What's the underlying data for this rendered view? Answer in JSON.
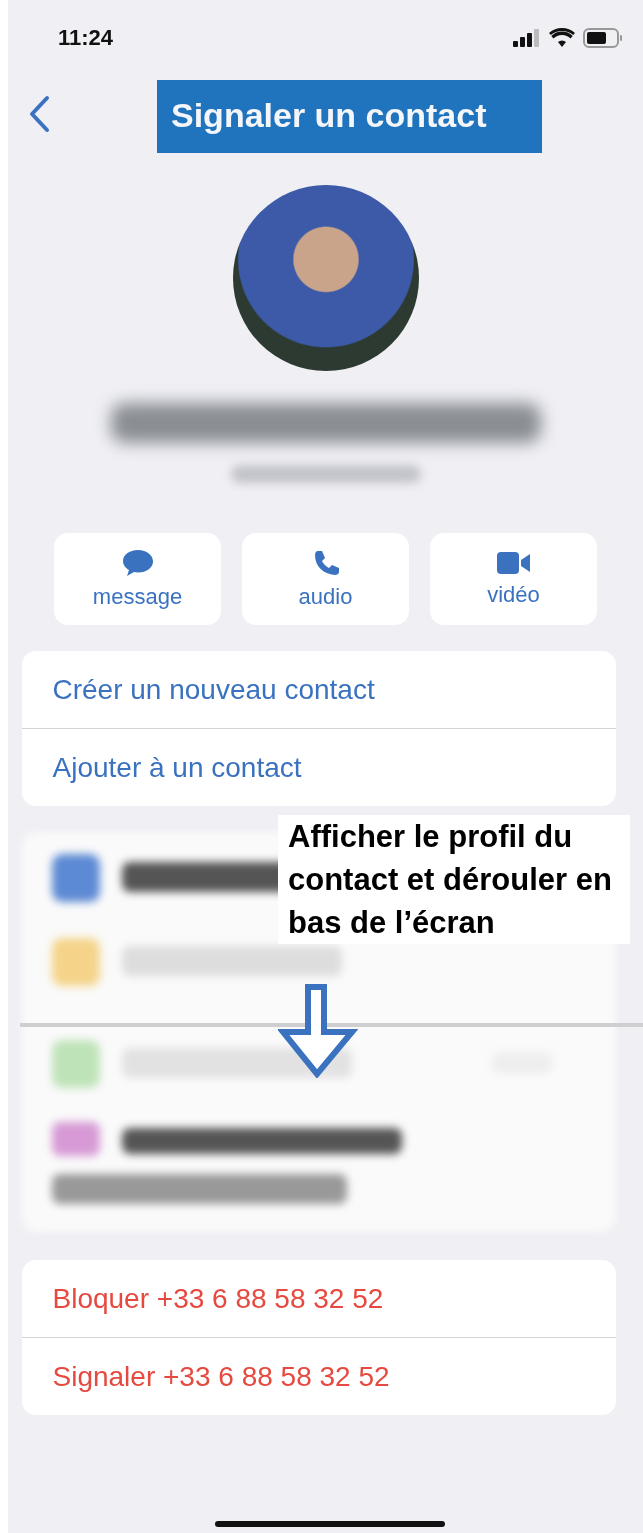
{
  "status_bar": {
    "time": "11:24"
  },
  "title": "Signaler un contact",
  "actions": [
    {
      "kind": "message",
      "label": "message"
    },
    {
      "kind": "audio",
      "label": "audio"
    },
    {
      "kind": "video",
      "label": "vidéo"
    }
  ],
  "contact_options": [
    "Créer un nouveau contact",
    "Ajouter à un contact"
  ],
  "annotation": "Afficher le profil du contact et dérouler en bas de l’écran",
  "danger_options": [
    "Bloquer +33 6 88 58 32 52",
    "Signaler +33 6 88 58 32 52"
  ]
}
